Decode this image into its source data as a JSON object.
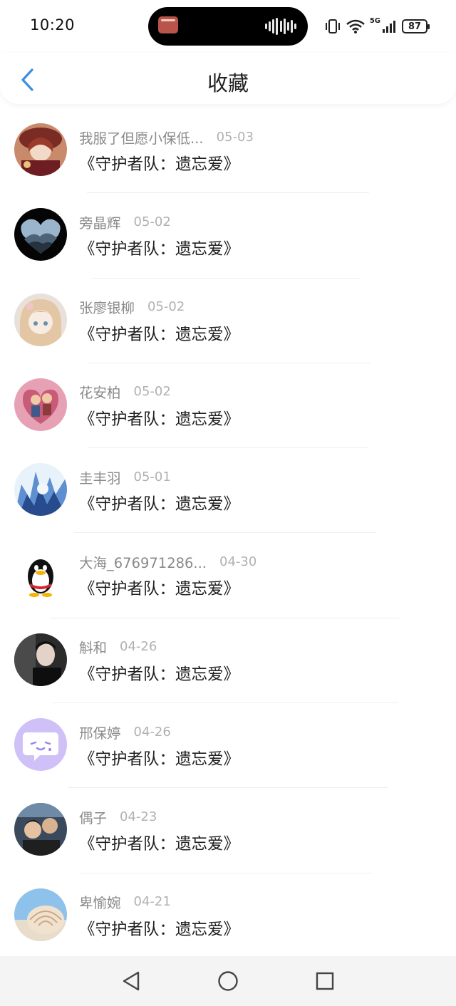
{
  "status_bar": {
    "time": "10:20",
    "network": "5G",
    "battery": "87"
  },
  "header": {
    "title": "收藏",
    "back_icon": "chevron-left-icon",
    "accent": "#3a8fe0"
  },
  "favorites": [
    {
      "username": "我服了但愿小保低...",
      "date": "05-03",
      "title": "《守护者队：遗忘爱》",
      "avatar": "anime-girl-red"
    },
    {
      "username": "旁晶辉",
      "date": "05-02",
      "title": "《守护者队：遗忘爱》",
      "avatar": "heart-mountain"
    },
    {
      "username": "张廖银柳",
      "date": "05-02",
      "title": "《守护者队：遗忘爱》",
      "avatar": "anime-girl-blonde"
    },
    {
      "username": "花安柏",
      "date": "05-02",
      "title": "《守护者队：遗忘爱》",
      "avatar": "cartoon-couple-pink"
    },
    {
      "username": "圭丰羽",
      "date": "05-01",
      "title": "《守护者队：遗忘爱》",
      "avatar": "anime-blue-ice"
    },
    {
      "username": "大海_676971286...",
      "date": "04-30",
      "title": "《守护者队：遗忘爱》",
      "avatar": "qq-penguin"
    },
    {
      "username": "斛和",
      "date": "04-26",
      "title": "《守护者队：遗忘爱》",
      "avatar": "photo-man-dark"
    },
    {
      "username": "邢保婷",
      "date": "04-26",
      "title": "《守护者队：遗忘爱》",
      "avatar": "chat-bubble-purple"
    },
    {
      "username": "偶子",
      "date": "04-23",
      "title": "《守护者队：遗忘爱》",
      "avatar": "photo-group"
    },
    {
      "username": "卑愉婉",
      "date": "04-21",
      "title": "《守护者队：遗忘爱》",
      "avatar": "seashell-beach"
    }
  ],
  "nav": {
    "back": "triangle-back-icon",
    "home": "circle-home-icon",
    "recents": "square-recents-icon"
  }
}
